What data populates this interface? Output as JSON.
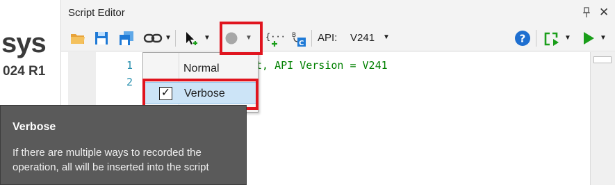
{
  "logo": {
    "main": "sys",
    "sub": "024 R1"
  },
  "window": {
    "title": "Script Editor",
    "pin_icon": "pin-icon",
    "close_glyph": "✕"
  },
  "toolbar": {
    "buttons": [
      "open-folder-icon",
      "save-icon",
      "save-as-icon",
      "link-icon",
      "selection-cursor-icon",
      "record-icon",
      "insert-snippet-icon",
      "convert-icon",
      "help-icon",
      "run-config-icon",
      "run-icon"
    ],
    "api_label": "API:",
    "api_value": "V241",
    "caret": "▼"
  },
  "editor": {
    "lines": [
      {
        "number": "1",
        "text": "t, API Version = V241"
      },
      {
        "number": "2",
        "text": ""
      }
    ]
  },
  "dropdown": {
    "items": [
      {
        "label": "Normal",
        "checked": false
      },
      {
        "label": "Verbose",
        "checked": true
      }
    ],
    "check_glyph": "✓"
  },
  "tooltip": {
    "title": "Verbose",
    "body": "If there are multiple ways to recorded the operation, all will be inserted into the script"
  },
  "colors": {
    "highlight": "#e0141e",
    "code_comment": "#008000",
    "line_number": "#2b91af",
    "run_green": "#1a9e1a",
    "help_blue": "#1e6fd0"
  }
}
